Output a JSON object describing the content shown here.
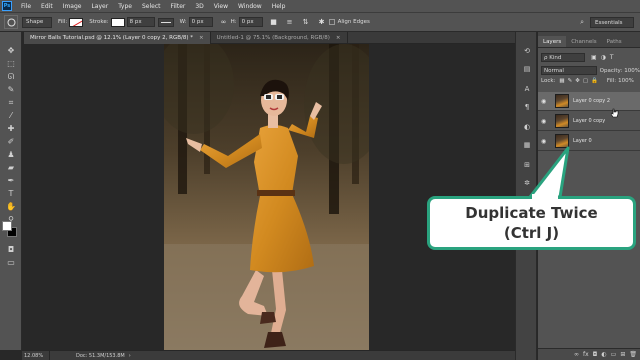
{
  "app": {
    "logo": "Ps",
    "menu": [
      "File",
      "Edit",
      "Image",
      "Layer",
      "Type",
      "Select",
      "Filter",
      "3D",
      "View",
      "Window",
      "Help"
    ]
  },
  "options": {
    "mode": "Shape",
    "fill_label": "Fill:",
    "stroke_label": "Stroke:",
    "stroke_width": "8 px",
    "w_label": "W:",
    "w_value": "0 px",
    "h_label": "H:",
    "h_value": "0 px",
    "align_edges": "Align Edges",
    "workspace": "Essentials"
  },
  "tabs": [
    {
      "label": "Mirror Balls Tutorial.psd @ 12.1% (Layer 0 copy 2, RGB/8) *",
      "active": true
    },
    {
      "label": "Untitled-1 @ 75.1% (Background, RGB/8)",
      "active": false
    }
  ],
  "tab_close": "×",
  "status": {
    "zoom": "12.08%",
    "doc": "Doc: 51.3M/153.8M",
    "arrow": "›"
  },
  "panel": {
    "tabs": [
      "Layers",
      "Channels",
      "Paths"
    ],
    "kind_label": "ρ Kind",
    "blend_mode": "Normal",
    "opacity_label": "Opacity:",
    "opacity_value": "100%",
    "lock_label": "Lock:",
    "fill_label": "Fill:",
    "fill_value": "100%",
    "layers": [
      {
        "name": "Layer 0 copy 2",
        "selected": true
      },
      {
        "name": "Layer 0 copy",
        "selected": false
      },
      {
        "name": "Layer 0",
        "selected": false
      }
    ],
    "bottom_icons": [
      "link-icon",
      "fx-icon",
      "mask-icon",
      "adjustment-icon",
      "folder-icon",
      "new-layer-icon",
      "trash-icon"
    ]
  },
  "callout": {
    "line1": "Duplicate Twice",
    "line2": "(Ctrl J)",
    "border_color": "#2aa37f"
  },
  "colors": {
    "foreground": "#ffffff",
    "background": "#000000"
  }
}
